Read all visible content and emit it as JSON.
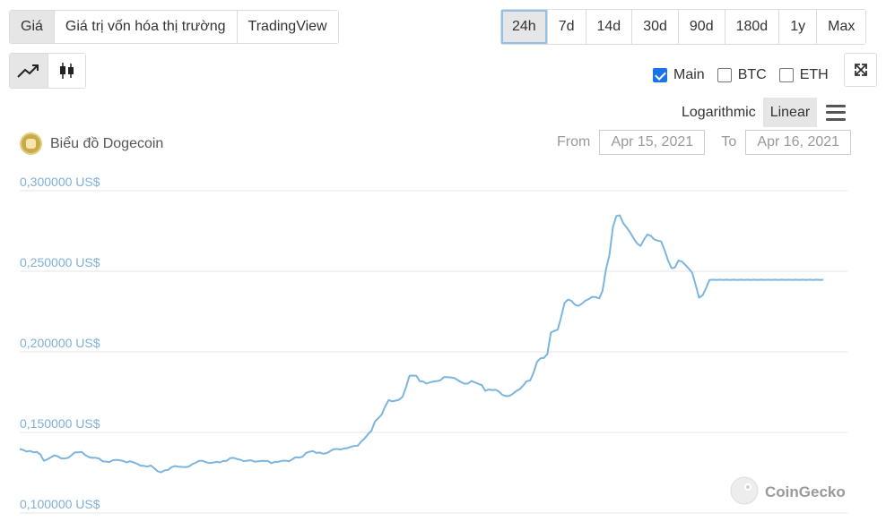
{
  "tabs": {
    "view": [
      {
        "label": "Giá",
        "active": true
      },
      {
        "label": "Giá trị vốn hóa thị trường",
        "active": false
      },
      {
        "label": "TradingView",
        "active": false
      }
    ],
    "range": [
      {
        "label": "24h",
        "active": true
      },
      {
        "label": "7d",
        "active": false
      },
      {
        "label": "14d",
        "active": false
      },
      {
        "label": "30d",
        "active": false
      },
      {
        "label": "90d",
        "active": false
      },
      {
        "label": "180d",
        "active": false
      },
      {
        "label": "1y",
        "active": false
      },
      {
        "label": "Max",
        "active": false
      }
    ]
  },
  "chart_type_icons": [
    "line-chart-icon",
    "candlestick-icon"
  ],
  "toggles": [
    {
      "label": "Main",
      "checked": true
    },
    {
      "label": "BTC",
      "checked": false
    },
    {
      "label": "ETH",
      "checked": false
    }
  ],
  "scale": {
    "log_label": "Logarithmic",
    "linear_label": "Linear",
    "active": "linear"
  },
  "title": "Biểu đồ Dogecoin",
  "daterange": {
    "from_label": "From",
    "from_value": "Apr 15, 2021",
    "to_label": "To",
    "to_value": "Apr 16, 2021"
  },
  "watermark": "CoinGecko",
  "colors": {
    "line": "#7cb5e0",
    "grid": "#e6e6e6",
    "axis_label": "#7fb0d6"
  },
  "chart_data": {
    "type": "line",
    "title": "Biểu đồ Dogecoin",
    "xlabel": "",
    "ylabel": "",
    "ylim": [
      0.1,
      0.3
    ],
    "yticks": [
      0.1,
      0.15,
      0.2,
      0.25,
      0.3
    ],
    "ytick_labels": [
      "0,100000 US$",
      "0,150000 US$",
      "0,200000 US$",
      "0,250000 US$",
      "0,300000 US$"
    ],
    "grid": true,
    "x": [
      0,
      2,
      4,
      6,
      8,
      10,
      12,
      14,
      16,
      18,
      20,
      22,
      24,
      26,
      28,
      30,
      32,
      34,
      36,
      38,
      40,
      42,
      44,
      46,
      48,
      50,
      52,
      54,
      56,
      58,
      60,
      62,
      64,
      66,
      68,
      70,
      72,
      74,
      76,
      78,
      80,
      82,
      84,
      86,
      88,
      90,
      92,
      94,
      96,
      98,
      100,
      102,
      104,
      106,
      108,
      110,
      112,
      114,
      116,
      118,
      120,
      122,
      124,
      126,
      128,
      130,
      132,
      134,
      136,
      138,
      140,
      142,
      144,
      146,
      148,
      150,
      152,
      154,
      156,
      158,
      160,
      162,
      164,
      166,
      168,
      170,
      172,
      174,
      176,
      178,
      180,
      182,
      184,
      186,
      188,
      190,
      192,
      194,
      196,
      198,
      200,
      202,
      204,
      206,
      208,
      210,
      212,
      214,
      216,
      218,
      220,
      222,
      224,
      226,
      228,
      230,
      232,
      234,
      236,
      238,
      240,
      242,
      244,
      246,
      248,
      250,
      252,
      254,
      256,
      258,
      260,
      262,
      264,
      266,
      268,
      270,
      272,
      274,
      276,
      278,
      280,
      282,
      284,
      286,
      288,
      290,
      292,
      294,
      296,
      298,
      300,
      302,
      304,
      306,
      308,
      310,
      312,
      314,
      316,
      318,
      320,
      322,
      324,
      326,
      328,
      330,
      332,
      334,
      336,
      338,
      340,
      342,
      344,
      346,
      348,
      350,
      352,
      354,
      356,
      358,
      360,
      362,
      364,
      366,
      368,
      370,
      372,
      374,
      376,
      378,
      380,
      382,
      384,
      386,
      388,
      390,
      392,
      394,
      396,
      398,
      400,
      402,
      404,
      406,
      408,
      410,
      412,
      414,
      416,
      418,
      420,
      422,
      424,
      426,
      428,
      430,
      432,
      434,
      436,
      438,
      440,
      442,
      444,
      446,
      448,
      450,
      452,
      454,
      456,
      458,
      460,
      462,
      464,
      466,
      468,
      470,
      472,
      474,
      476,
      478,
      480
    ],
    "y": [
      0.1397,
      0.1391,
      0.1381,
      0.1385,
      0.1376,
      0.1379,
      0.1363,
      0.1324,
      0.1333,
      0.1345,
      0.1358,
      0.1352,
      0.1339,
      0.1338,
      0.1342,
      0.1358,
      0.1376,
      0.1376,
      0.1379,
      0.1359,
      0.1347,
      0.1342,
      0.1343,
      0.1338,
      0.1321,
      0.1319,
      0.1316,
      0.1327,
      0.133,
      0.1327,
      0.1323,
      0.1314,
      0.1321,
      0.1314,
      0.1306,
      0.1294,
      0.1292,
      0.1288,
      0.1295,
      0.1278,
      0.1259,
      0.1253,
      0.1264,
      0.1268,
      0.1284,
      0.1291,
      0.1288,
      0.1286,
      0.1285,
      0.1287,
      0.1303,
      0.1311,
      0.1324,
      0.1324,
      0.1315,
      0.131,
      0.1312,
      0.1317,
      0.1314,
      0.1322,
      0.1324,
      0.134,
      0.1342,
      0.1335,
      0.133,
      0.1321,
      0.1325,
      0.1327,
      0.1319,
      0.132,
      0.1323,
      0.1324,
      0.1322,
      0.1309,
      0.1318,
      0.1317,
      0.1324,
      0.1325,
      0.1321,
      0.1333,
      0.1346,
      0.1344,
      0.1349,
      0.1373,
      0.138,
      0.1384,
      0.1373,
      0.1375,
      0.1368,
      0.1371,
      0.1384,
      0.1396,
      0.1397,
      0.1394,
      0.14,
      0.1403,
      0.141,
      0.1416,
      0.1417,
      0.1442,
      0.1462,
      0.1489,
      0.1511,
      0.1568,
      0.1589,
      0.1612,
      0.1664,
      0.1701,
      0.1692,
      0.1697,
      0.1703,
      0.1721,
      0.1779,
      0.1851,
      0.1853,
      0.1851,
      0.1817,
      0.1815,
      0.1803,
      0.1811,
      0.1816,
      0.1818,
      0.1824,
      0.1843,
      0.1843,
      0.1841,
      0.1838,
      0.1825,
      0.1811,
      0.1802,
      0.1804,
      0.1819,
      0.181,
      0.1801,
      0.1794,
      0.1758,
      0.1766,
      0.1763,
      0.1765,
      0.1752,
      0.1732,
      0.1725,
      0.1727,
      0.174,
      0.1757,
      0.1769,
      0.1791,
      0.1818,
      0.1822,
      0.1871,
      0.1938,
      0.196,
      0.1962,
      0.1987,
      0.212,
      0.213,
      0.2138,
      0.2217,
      0.2304,
      0.2325,
      0.2316,
      0.2292,
      0.2285,
      0.2299,
      0.2317,
      0.2328,
      0.2341,
      0.234,
      0.2331,
      0.2379,
      0.2514,
      0.2601,
      0.2774,
      0.2843,
      0.2847,
      0.2798,
      0.2771,
      0.2741,
      0.2704,
      0.2673,
      0.2657,
      0.2696,
      0.2728,
      0.272,
      0.2698,
      0.269,
      0.2685,
      0.263,
      0.2566,
      0.2519,
      0.2524,
      0.2567,
      0.256,
      0.254,
      0.2516,
      0.2491,
      0.2414,
      0.2336,
      0.2351,
      0.2395,
      0.2446,
      0.2448,
      0.2446,
      0.2448,
      0.2446,
      0.2448,
      0.2446,
      0.2448,
      0.2446,
      0.2448,
      0.2446,
      0.2448,
      0.2446,
      0.2448,
      0.2446,
      0.2448,
      0.2446,
      0.2448,
      0.2446,
      0.2448,
      0.2446,
      0.2448,
      0.2446,
      0.2448,
      0.2446,
      0.2448,
      0.2446,
      0.2448,
      0.2446,
      0.2448,
      0.2446,
      0.2448,
      0.2446,
      0.2448
    ],
    "series": [
      {
        "name": "Main"
      }
    ]
  }
}
